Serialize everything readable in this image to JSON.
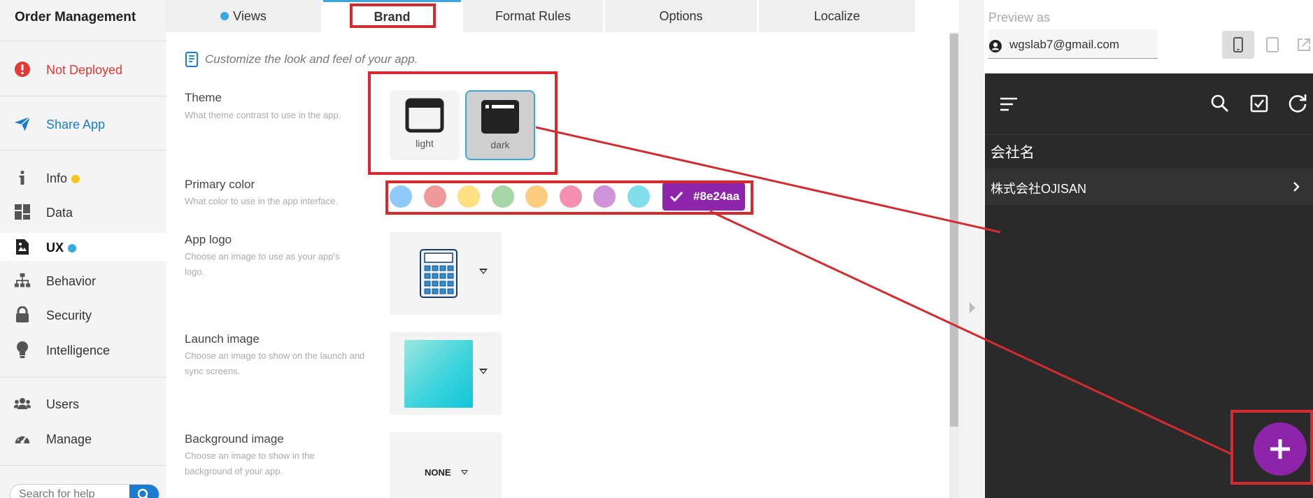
{
  "sidebar": {
    "app_title": "Order Management",
    "deploy_status": "Not Deployed",
    "share": "Share App",
    "items": [
      {
        "label": "Info",
        "badge_color": "#f5c518"
      },
      {
        "label": "Data"
      },
      {
        "label": "UX",
        "badge_color": "#3aa8e0"
      },
      {
        "label": "Behavior"
      },
      {
        "label": "Security"
      },
      {
        "label": "Intelligence"
      },
      {
        "label": "Users"
      },
      {
        "label": "Manage"
      }
    ],
    "search_placeholder": "Search for help"
  },
  "tabs": [
    "Views",
    "Brand",
    "Format Rules",
    "Options",
    "Localize"
  ],
  "active_tab": "Brand",
  "views_badge_color": "#3aa8e0",
  "brand": {
    "hint": "Customize the look and feel of your app.",
    "theme": {
      "label": "Theme",
      "desc": "What theme contrast to use in the app.",
      "options": [
        "light",
        "dark"
      ],
      "selected": "dark"
    },
    "primary_color": {
      "label": "Primary color",
      "desc": "What color to use in the app interface.",
      "swatches": [
        "#90caf9",
        "#ef9a9a",
        "#ffe082",
        "#a5d6a7",
        "#ffcc80",
        "#f48fb1",
        "#ce93d8",
        "#80deea"
      ],
      "selected": "#8e24aa"
    },
    "app_logo": {
      "label": "App logo",
      "desc": "Choose an image to use as your app's logo."
    },
    "launch_image": {
      "label": "Launch image",
      "desc": "Choose an image to show on the launch and sync screens."
    },
    "background_image": {
      "label": "Background image",
      "desc": "Choose an image to show in the background of your app.",
      "value": "NONE"
    }
  },
  "preview": {
    "label": "Preview as",
    "user": "wgslab7@gmail.com",
    "column_header": "会社名",
    "row_value": "株式会社OJISAN",
    "accent": "#8e24aa"
  },
  "annotation_color": "#d42a30"
}
